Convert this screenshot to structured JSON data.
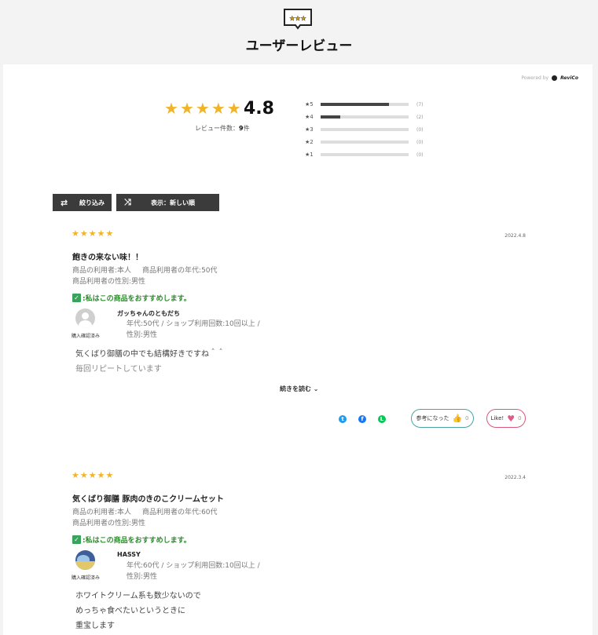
{
  "header": {
    "icon": "speech-bubble-stars-icon",
    "title": "ユーザーレビュー"
  },
  "powered": {
    "label": "Powered by",
    "brand": "ReviCo"
  },
  "summary": {
    "score": "4.8",
    "count_label": "レビュー件数：",
    "count_value": "9",
    "count_unit": "件",
    "stars": 5,
    "distribution": [
      {
        "label": "★5",
        "count": "(7)",
        "fraction": 0.78
      },
      {
        "label": "★4",
        "count": "(2)",
        "fraction": 0.22
      },
      {
        "label": "★3",
        "count": "(0)",
        "fraction": 0
      },
      {
        "label": "★2",
        "count": "(0)",
        "fraction": 0
      },
      {
        "label": "★1",
        "count": "(0)",
        "fraction": 0
      }
    ]
  },
  "controls": {
    "filter_label": "絞り込み",
    "sort_label": "表示：新しい順"
  },
  "reviews": [
    {
      "stars": 5,
      "date": "2022.4.8",
      "title": "飽きの来ない味！！",
      "meta_line1_a": "商品の利用者:本人",
      "meta_line1_b": "商品利用者の年代:50代",
      "meta_line2": "商品利用者の性別:男性",
      "recommend": ":私はこの商品をおすすめします。",
      "verified": "購入確認済み",
      "user": "ガッちゃんのともだち",
      "user_meta1": "年代:50代 / ショップ利用回数:10回以上 /",
      "user_meta2": "性別:男性",
      "body1": "気くばり御膳の中でも結構好きですね＾＾",
      "body2": "毎回リピートしています",
      "more": "続きを読む ⌄",
      "helpful_label": "参考になった",
      "helpful_count": "0",
      "like_label": "Like!",
      "like_count": "0"
    },
    {
      "stars": 5,
      "date": "2022.3.4",
      "title": "気くばり御膳 豚肉のきのこクリームセット",
      "meta_line1_a": "商品の利用者:本人",
      "meta_line1_b": "商品利用者の年代:60代",
      "meta_line2": "商品利用者の性別:男性",
      "recommend": ":私はこの商品をおすすめします。",
      "verified": "購入確認済み",
      "user": "HASSY",
      "user_meta1": "年代:60代 / ショップ利用回数:10回以上 /",
      "user_meta2": "性別:男性",
      "body1": "ホワイトクリーム系も数少ないので",
      "body2": "めっちゃ食べたいというときに",
      "body3": "重宝します"
    }
  ]
}
